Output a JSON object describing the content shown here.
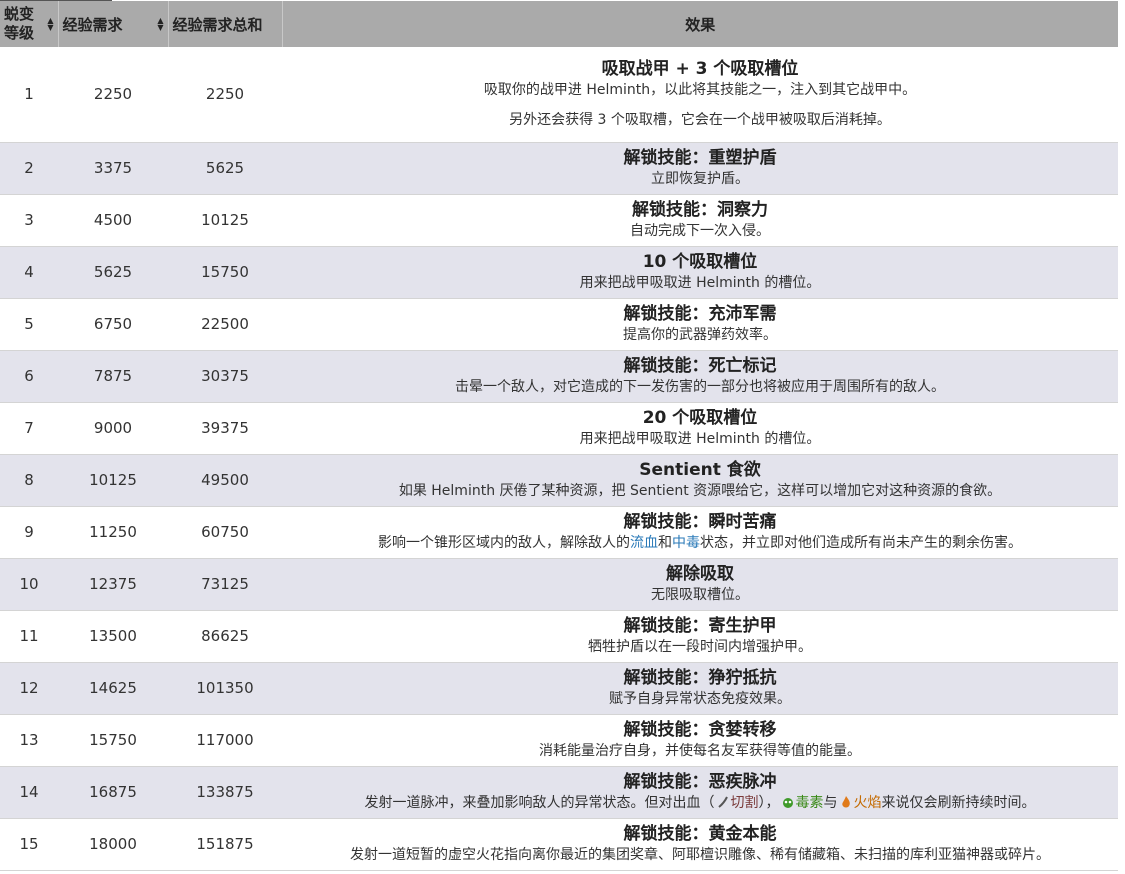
{
  "headers": {
    "level": "蜕变等级",
    "xp": "经验需求",
    "total": "经验需求总和",
    "effect": "效果"
  },
  "rows": [
    {
      "level": "1",
      "xp": "2250",
      "total": "2250",
      "title": "吸取战甲 + 3 个吸取槽位",
      "desc": "吸取你的战甲进 Helminth，以此将其技能之一，注入到其它战甲中。",
      "desc2": "另外还会获得 3 个吸取槽，它会在一个战甲被吸取后消耗掉。"
    },
    {
      "level": "2",
      "xp": "3375",
      "total": "5625",
      "title": "解锁技能：重塑护盾",
      "desc": "立即恢复护盾。"
    },
    {
      "level": "3",
      "xp": "4500",
      "total": "10125",
      "title": "解锁技能：洞察力",
      "desc": "自动完成下一次入侵。"
    },
    {
      "level": "4",
      "xp": "5625",
      "total": "15750",
      "title": "10 个吸取槽位",
      "desc": "用来把战甲吸取进 Helminth 的槽位。"
    },
    {
      "level": "5",
      "xp": "6750",
      "total": "22500",
      "title": "解锁技能：充沛军需",
      "desc": "提高你的武器弹药效率。"
    },
    {
      "level": "6",
      "xp": "7875",
      "total": "30375",
      "title": "解锁技能：死亡标记",
      "desc": "击晕一个敌人，对它造成的下一发伤害的一部分也将被应用于周围所有的敌人。"
    },
    {
      "level": "7",
      "xp": "9000",
      "total": "39375",
      "title": "20 个吸取槽位",
      "desc": "用来把战甲吸取进 Helminth 的槽位。"
    },
    {
      "level": "8",
      "xp": "10125",
      "total": "49500",
      "title": "Sentient 食欲",
      "desc": "如果 Helminth 厌倦了某种资源，把 Sentient 资源喂给它，这样可以增加它对这种资源的食欲。"
    },
    {
      "level": "9",
      "xp": "11250",
      "total": "60750",
      "title": "解锁技能：瞬时苦痛",
      "desc_pre": "影响一个锥形区域内的敌人，解除敌人的",
      "link1": "流血",
      "desc_mid": "和",
      "link2": "中毒",
      "desc_post": "状态，并立即对他们造成所有尚未产生的剩余伤害。"
    },
    {
      "level": "10",
      "xp": "12375",
      "total": "73125",
      "title": "解除吸取",
      "desc": "无限吸取槽位。"
    },
    {
      "level": "11",
      "xp": "13500",
      "total": "86625",
      "title": "解锁技能：寄生护甲",
      "desc": "牺牲护盾以在一段时间内增强护甲。"
    },
    {
      "level": "12",
      "xp": "14625",
      "total": "101350",
      "title": "解锁技能：狰狞抵抗",
      "desc": "赋予自身异常状态免疫效果。"
    },
    {
      "level": "13",
      "xp": "15750",
      "total": "117000",
      "title": "解锁技能：贪婪转移",
      "desc": "消耗能量治疗自身，并使每名友军获得等值的能量。"
    },
    {
      "level": "14",
      "xp": "16875",
      "total": "133875",
      "title": "解锁技能：恶疾脉冲",
      "desc_pre": "发射一道脉冲，来叠加影响敌人的异常状态。但对出血（",
      "slash": "切割",
      "desc_mid": "），",
      "toxin": "毒素",
      "desc_mid2": "与",
      "fire": "火焰",
      "desc_post": "来说仅会刷新持续时间。"
    },
    {
      "level": "15",
      "xp": "18000",
      "total": "151875",
      "title": "解锁技能：黄金本能",
      "desc": "发射一道短暂的虚空火花指向离你最近的集团奖章、阿耶檀识雕像、稀有储藏箱、未扫描的库利亚猫神器或碎片。"
    }
  ]
}
